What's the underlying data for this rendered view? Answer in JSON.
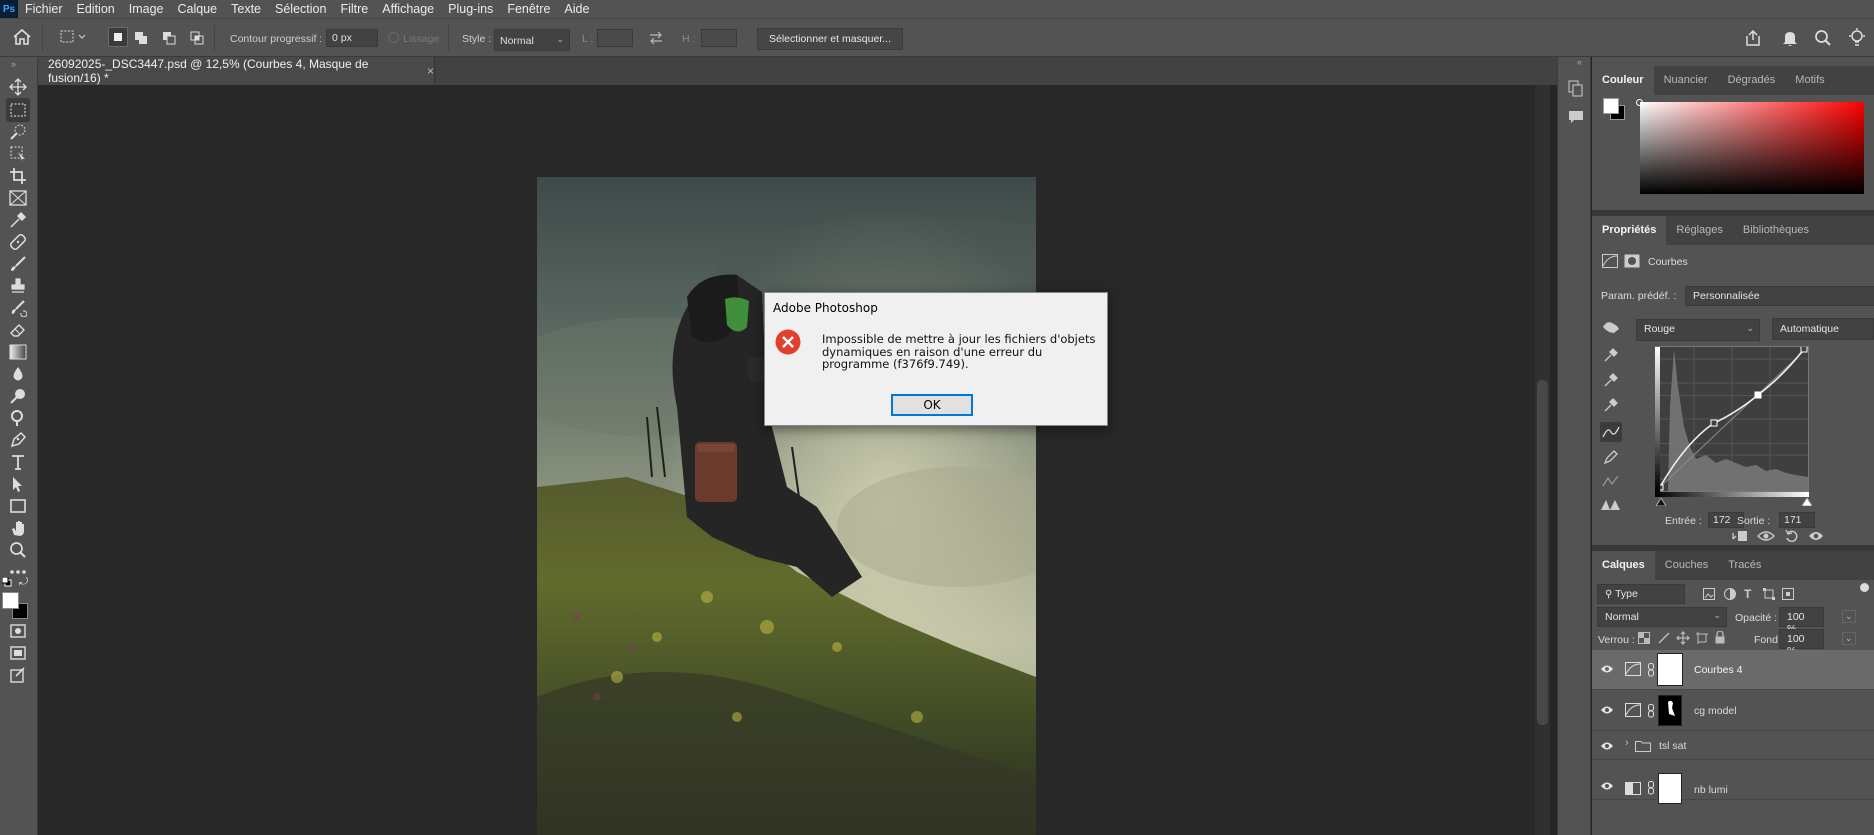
{
  "app": {
    "logo": "Ps"
  },
  "menu": [
    "Fichier",
    "Edition",
    "Image",
    "Calque",
    "Texte",
    "Sélection",
    "Filtre",
    "Affichage",
    "Plug-ins",
    "Fenêtre",
    "Aide"
  ],
  "options": {
    "feather_label": "Contour progressif :",
    "feather_value": "0 px",
    "antialias_label": "Lissage",
    "style_label": "Style :",
    "style_value": "Normal",
    "width_label": "L :",
    "height_label": "H :",
    "select_mask_button": "Sélectionner et masquer..."
  },
  "document": {
    "tab_title": "26092025-_DSC3447.psd @ 12,5% (Courbes 4, Masque de fusion/16) *"
  },
  "color_panel": {
    "tabs": [
      "Couleur",
      "Nuancier",
      "Dégradés",
      "Motifs"
    ],
    "active": "Couleur"
  },
  "properties_panel": {
    "tabs": [
      "Propriétés",
      "Réglages",
      "Bibliothèques"
    ],
    "title": "Courbes",
    "preset_label": "Param. prédéf. :",
    "preset_value": "Personnalisée",
    "channel_value": "Rouge",
    "auto_button": "Automatique",
    "input_label": "Entrée :",
    "input_value": "172",
    "output_label": "Sortie :",
    "output_value": "171"
  },
  "layers_panel": {
    "tabs": [
      "Calques",
      "Couches",
      "Tracés"
    ],
    "filter_value": "Type",
    "blend_mode": "Normal",
    "opacity_label": "Opacité :",
    "opacity_value": "100 %",
    "lock_label": "Verrou :",
    "fill_label": "Fond :",
    "fill_value": "100 %",
    "layers": [
      {
        "name": "Courbes 4",
        "selected": true
      },
      {
        "name": "cg model",
        "selected": false
      },
      {
        "name": "tsl sat",
        "selected": false
      },
      {
        "name": "nb lumi",
        "selected": false
      }
    ]
  },
  "dialog": {
    "title": "Adobe Photoshop",
    "message": "Impossible de mettre à jour les fichiers d'objets dynamiques en raison d'une erreur du programme (f376f9.749).",
    "ok_label": "OK",
    "icon": "error-icon"
  },
  "colors": {
    "accent": "#0078d7",
    "error": "#e0412f",
    "ui_bg": "#535353"
  }
}
